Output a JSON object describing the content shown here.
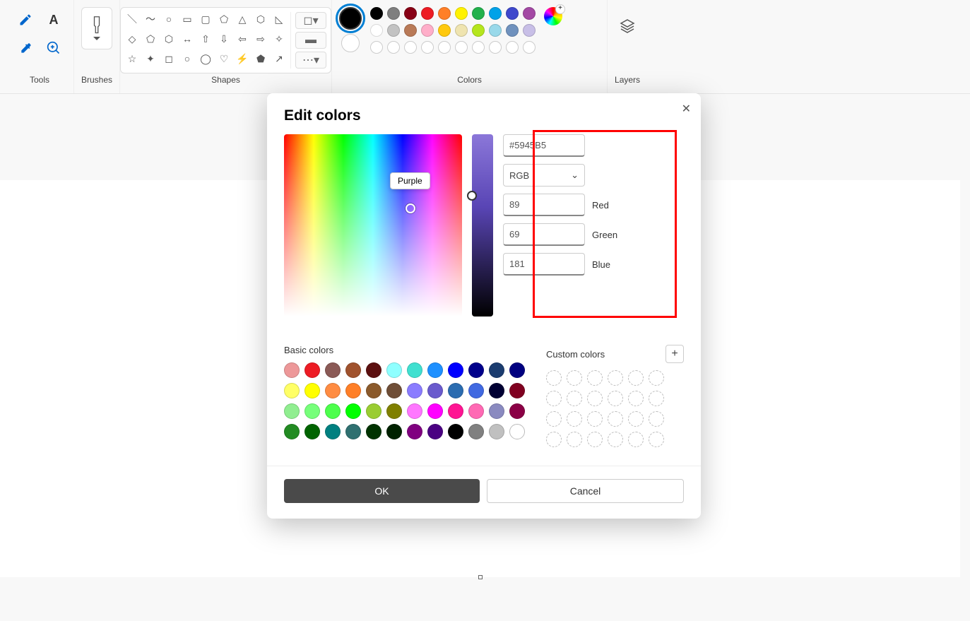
{
  "ribbon": {
    "tools_label": "Tools",
    "brushes_label": "Brushes",
    "shapes_label": "Shapes",
    "colors_label": "Colors",
    "layers_label": "Layers",
    "palette_row1": [
      "#000000",
      "#7f7f7f",
      "#880015",
      "#ed1c24",
      "#ff7f27",
      "#fff200",
      "#22b14c",
      "#00a2e8",
      "#3f48cc",
      "#a349a4"
    ],
    "palette_row2": [
      "#ffffff",
      "#c3c3c3",
      "#b97a57",
      "#ffaec9",
      "#ffc90e",
      "#efe4b0",
      "#b5e61d",
      "#99d9ea",
      "#7092be",
      "#c8bfe7"
    ]
  },
  "dialog": {
    "title": "Edit colors",
    "tooltip": "Purple",
    "hex": "#5945B5",
    "mode": "RGB",
    "red": "89",
    "red_label": "Red",
    "green": "69",
    "green_label": "Green",
    "blue": "181",
    "blue_label": "Blue",
    "basic_label": "Basic colors",
    "custom_label": "Custom colors",
    "basic_colors": [
      "#ed9899",
      "#ed1c24",
      "#8b5a56",
      "#a0522d",
      "#5c1010",
      "#8fffff",
      "#40e0d0",
      "#1e90ff",
      "#0000ff",
      "#00008b",
      "#1b3c6f",
      "#000080",
      "#ffff66",
      "#ffff00",
      "#ff8c42",
      "#ff7f27",
      "#8b5a2b",
      "#6f4e37",
      "#8a7cff",
      "#6a5acd",
      "#2b6cb0",
      "#4169e1",
      "#000033",
      "#800020",
      "#90ee90",
      "#76ff7a",
      "#4cff4c",
      "#00ff00",
      "#9acd32",
      "#808000",
      "#ff77ff",
      "#ff00ff",
      "#ff1493",
      "#ff69b4",
      "#8a8ac0",
      "#8b0045",
      "#228b22",
      "#006400",
      "#008080",
      "#2f7070",
      "#003300",
      "#002200",
      "#800080",
      "#4b0082",
      "#000000",
      "#808080",
      "#c0c0c0",
      "#ffffff"
    ],
    "ok": "OK",
    "cancel": "Cancel"
  }
}
